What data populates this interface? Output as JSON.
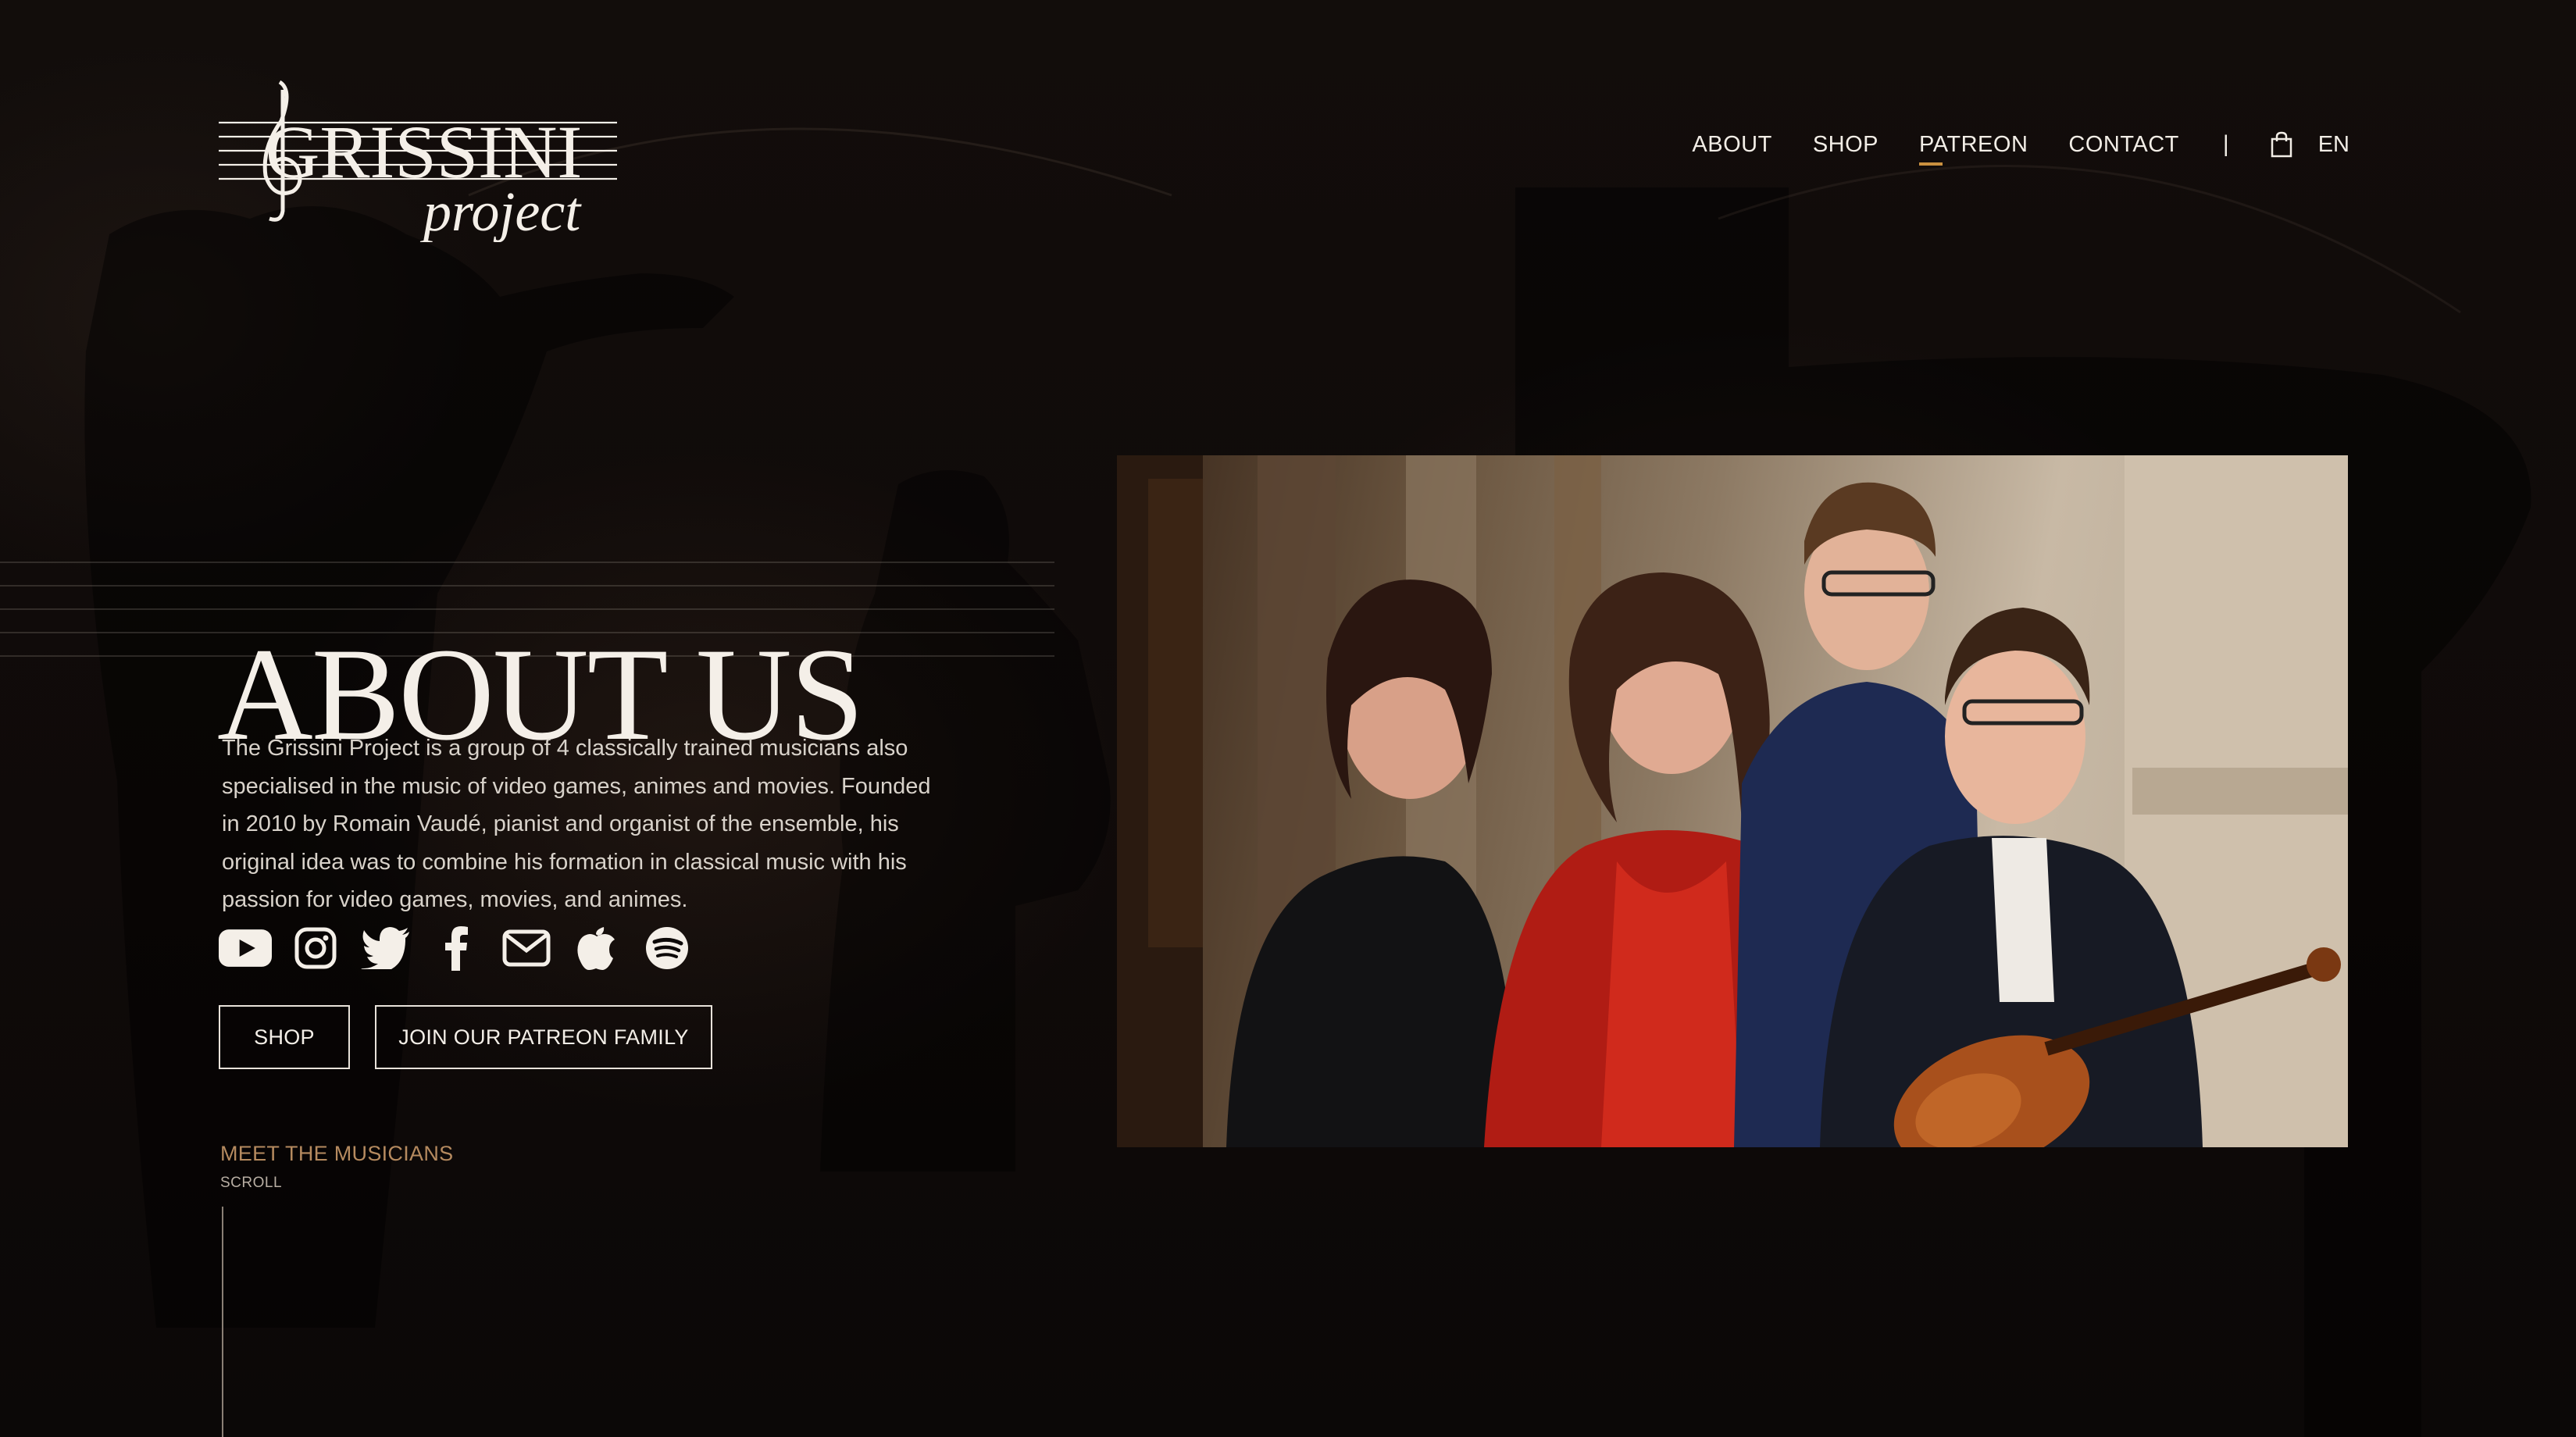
{
  "brand": {
    "name": "GRISSINI",
    "tagline": "project"
  },
  "nav": {
    "items": [
      {
        "label": "ABOUT"
      },
      {
        "label": "SHOP"
      },
      {
        "label": "PATREON"
      },
      {
        "label": "CONTACT"
      }
    ],
    "separator": "|",
    "language": "EN",
    "active_item": "PATREON",
    "cart_icon": "shopping-bag-icon"
  },
  "hero": {
    "title": "ABOUT US",
    "description": "The Grissini Project is a group of 4 classically trained musicians also specialised in the music of video games, animes and movies. Founded in 2010 by Romain Vaudé, pianist and organist of the ensemble, his original idea was to combine his formation in classical music with his passion for video games, movies, and animes."
  },
  "social": [
    {
      "icon": "youtube-icon"
    },
    {
      "icon": "instagram-icon"
    },
    {
      "icon": "twitter-icon"
    },
    {
      "icon": "facebook-icon"
    },
    {
      "icon": "email-icon"
    },
    {
      "icon": "apple-icon"
    },
    {
      "icon": "spotify-icon"
    }
  ],
  "buttons": {
    "shop": "SHOP",
    "patreon": "JOIN OUR PATREON FAMILY"
  },
  "scroll_section": {
    "meet": "MEET THE MUSICIANS",
    "scroll": "SCROLL"
  },
  "colors": {
    "background": "#0d0908",
    "accent": "#c9903f",
    "meet_text": "#b58a5f",
    "text": "#f4efe8"
  }
}
